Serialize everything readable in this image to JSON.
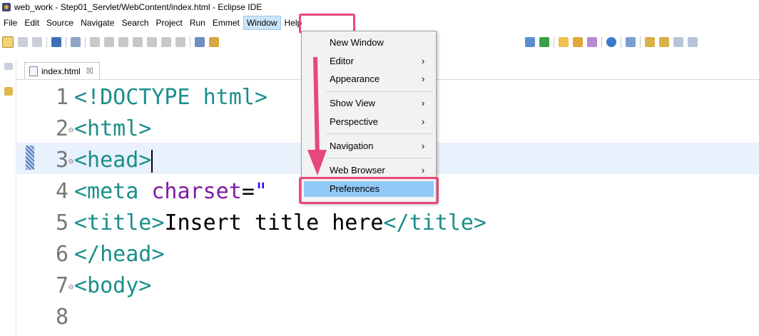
{
  "window": {
    "title": "web_work - Step01_Servlet/WebContent/index.html - Eclipse IDE"
  },
  "menubar": {
    "items": [
      {
        "label": "File"
      },
      {
        "label": "Edit"
      },
      {
        "label": "Source"
      },
      {
        "label": "Navigate"
      },
      {
        "label": "Search"
      },
      {
        "label": "Project"
      },
      {
        "label": "Run"
      },
      {
        "label": "Emmet"
      },
      {
        "label": "Window"
      },
      {
        "label": "Help"
      }
    ],
    "active": "Window"
  },
  "editor": {
    "tab_label": "index.html",
    "tab_close": "☒",
    "lines": [
      {
        "number": "1",
        "fold": false,
        "parts": [
          {
            "c": "tag",
            "t": "<!DOCTYPE html>"
          }
        ]
      },
      {
        "number": "2",
        "fold": true,
        "parts": [
          {
            "c": "tag",
            "t": "<html>"
          }
        ]
      },
      {
        "number": "3",
        "fold": true,
        "parts": [
          {
            "c": "tag",
            "t": "<head>"
          }
        ],
        "current": true
      },
      {
        "number": "4",
        "fold": false,
        "parts": [
          {
            "c": "tag",
            "t": "<meta "
          },
          {
            "c": "attr",
            "t": "charset"
          },
          {
            "c": "txt",
            "t": "="
          },
          {
            "c": "str",
            "t": "\""
          }
        ]
      },
      {
        "number": "5",
        "fold": false,
        "parts": [
          {
            "c": "tag",
            "t": "<title>"
          },
          {
            "c": "txt",
            "t": "Insert title here"
          },
          {
            "c": "tag",
            "t": "</title>"
          }
        ]
      },
      {
        "number": "6",
        "fold": false,
        "parts": [
          {
            "c": "tag",
            "t": "</head>"
          }
        ]
      },
      {
        "number": "7",
        "fold": true,
        "parts": [
          {
            "c": "tag",
            "t": "<body>"
          }
        ]
      },
      {
        "number": "8",
        "fold": false,
        "parts": []
      }
    ]
  },
  "window_menu": {
    "items": [
      {
        "label": "New Window",
        "submenu": false
      },
      {
        "label": "Editor",
        "submenu": true
      },
      {
        "label": "Appearance",
        "submenu": true
      },
      {
        "label": "Show View",
        "submenu": true
      },
      {
        "label": "Perspective",
        "submenu": true
      },
      {
        "label": "Navigation",
        "submenu": true
      },
      {
        "label": "Web Browser",
        "submenu": true
      },
      {
        "label": "Preferences",
        "submenu": false,
        "selected": true
      }
    ]
  },
  "annotation": {
    "color": "#e8477a"
  }
}
